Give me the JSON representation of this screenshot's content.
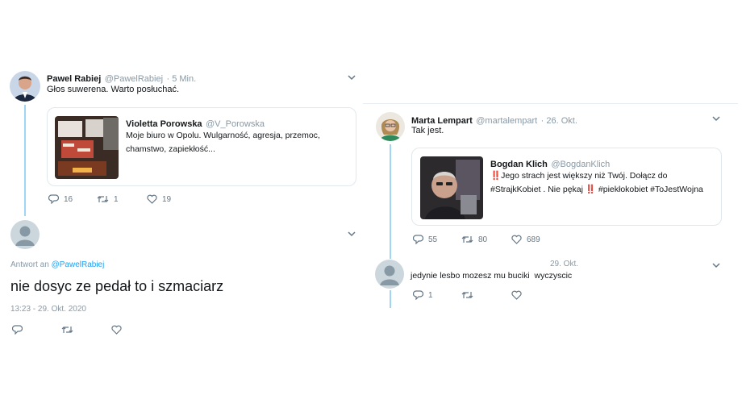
{
  "left": {
    "tweet": {
      "name": "Pawel Rabiej",
      "handle": "@PawelRabiej",
      "time": "· 5 Min.",
      "text": "Głos suwerena. Warto posłuchać.",
      "quote": {
        "name": "Violetta Porowska",
        "handle": "@V_Porowska",
        "text_line1": "Moje biuro w Opolu. Wulgarność, agresja, przemoc,",
        "text_line2": "chamstwo, zapiekłość..."
      },
      "actions": {
        "reply": "16",
        "retweet": "1",
        "like": "19"
      }
    },
    "reply": {
      "replying_to_prefix": "Antwort an",
      "replying_to_handle": "@PawelRabiej",
      "text": "nie dosyc ze pedał to i szmaciarz",
      "timestamp": "13:23 - 29. Okt. 2020"
    }
  },
  "right": {
    "tweet": {
      "name": "Marta Lempart",
      "handle": "@martalempart",
      "time": "· 26. Okt.",
      "text": "Tak jest.",
      "quote": {
        "name": "Bogdan Klich",
        "handle": "@BogdanKlich",
        "emoji": "‼️",
        "line1": "Jego strach jest większy niż Twój. Dołącz do",
        "line2a": "#StrajkKobiet . Nie pękaj",
        "line2b": "#piekłokobiet #ToJestWojna"
      },
      "actions": {
        "reply": "55",
        "retweet": "80",
        "like": "689"
      }
    },
    "reply": {
      "time": "29. Okt.",
      "text": "jedynie lesbo mozesz mu buciki  wyczyscic",
      "actions": {
        "reply": "1"
      }
    }
  },
  "colors": {
    "thread": "#9fd6f5",
    "link": "#1da1f2",
    "muted": "#8899a6"
  }
}
